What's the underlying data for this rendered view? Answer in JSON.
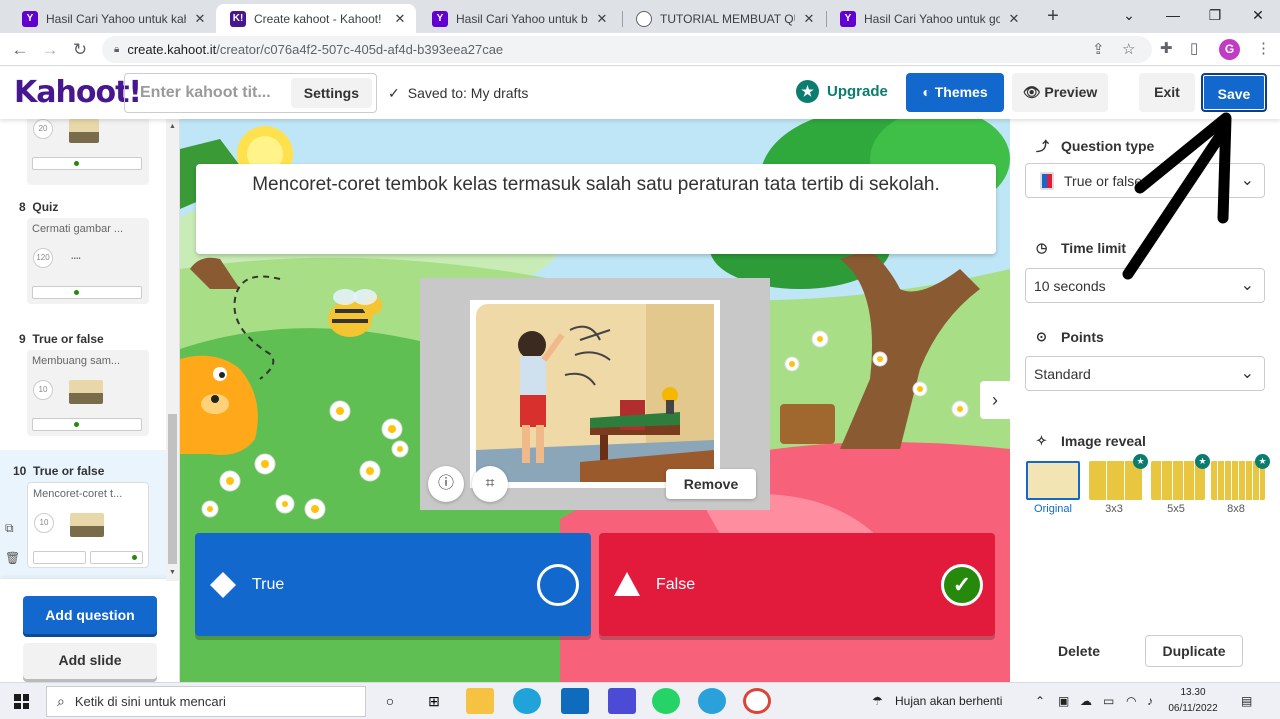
{
  "browser": {
    "tabs": [
      {
        "title": "Hasil Cari Yahoo untuk kahoot",
        "favicon": "yahoo-icon",
        "active": false
      },
      {
        "title": "Create kahoot - Kahoot!",
        "favicon": "kahoot-icon",
        "active": true
      },
      {
        "title": "Hasil Cari Yahoo untuk blog d",
        "favicon": "yahoo-icon",
        "active": false
      },
      {
        "title": "TUTORIAL MEMBUAT QUIS O",
        "favicon": "globe-icon",
        "active": false
      },
      {
        "title": "Hasil Cari Yahoo untuk goog",
        "favicon": "yahoo-icon",
        "active": false
      }
    ],
    "url_host": "create.kahoot.it",
    "url_path": "/creator/c076a4f2-507c-405d-af4d-b393eea27cae",
    "profile_initial": "G"
  },
  "header": {
    "logo": "Kahoot!",
    "title_placeholder": "Enter kahoot tit...",
    "settings_label": "Settings",
    "saved_text": "Saved to: My drafts",
    "upgrade_label": "Upgrade",
    "themes_label": "Themes",
    "preview_label": "Preview",
    "exit_label": "Exit",
    "save_label": "Save"
  },
  "slides": [
    {
      "number": "",
      "type": "",
      "question": "",
      "time": "20"
    },
    {
      "number": "8",
      "type": "Quiz",
      "question": "Cermati gambar ...",
      "time": "120"
    },
    {
      "number": "9",
      "type": "True or false",
      "question": "Membuang sam...",
      "time": "10"
    },
    {
      "number": "10",
      "type": "True or false",
      "question": "Mencoret-coret t...",
      "time": "10"
    }
  ],
  "sidebar": {
    "add_question_label": "Add question",
    "add_slide_label": "Add slide"
  },
  "editor": {
    "question_text": "Mencoret-coret tembok kelas termasuk salah satu peraturan tata tertib di sekolah.",
    "remove_label": "Remove",
    "answers": [
      {
        "label": "True",
        "color": "#1368ce",
        "correct": false
      },
      {
        "label": "False",
        "color": "#e21b3c",
        "correct": true
      }
    ]
  },
  "panel": {
    "question_type_label": "Question type",
    "question_type_value": "True or false",
    "time_limit_label": "Time limit",
    "time_limit_value": "10 seconds",
    "points_label": "Points",
    "points_value": "Standard",
    "image_reveal_label": "Image reveal",
    "reveal_options": [
      "Original",
      "3x3",
      "5x5",
      "8x8"
    ],
    "delete_label": "Delete",
    "duplicate_label": "Duplicate"
  },
  "taskbar": {
    "search_placeholder": "Ketik di sini untuk mencari",
    "weather_text": "Hujan akan berhenti",
    "time": "13.30",
    "date": "06/11/2022"
  },
  "colors": {
    "kahoot_purple": "#46178f",
    "primary_blue": "#1368ce",
    "true_blue": "#1368ce",
    "false_red": "#e21b3c",
    "correct_green": "#26890c",
    "upgrade_teal": "#0a7d6e"
  }
}
